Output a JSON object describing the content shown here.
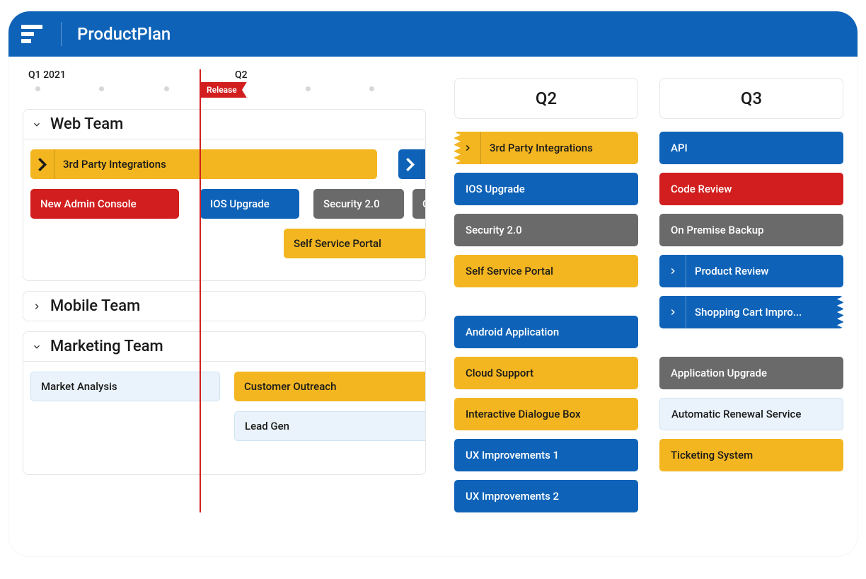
{
  "app_name": "ProductPlan",
  "timeline": {
    "q1_label": "Q1 2021",
    "q2_label": "Q2",
    "release_tag": "Release"
  },
  "lanes": {
    "web": {
      "name": "Web Team",
      "bars": {
        "third_party": "3rd Party Integrations",
        "new_admin": "New Admin Console",
        "ios": "IOS Upgrade",
        "security": "Security 2.0",
        "on_prem": "On",
        "self_serve": "Self Service Portal"
      }
    },
    "mobile": {
      "name": "Mobile Team"
    },
    "marketing": {
      "name": "Marketing Team",
      "bars": {
        "market": "Market Analysis",
        "outreach": "Customer Outreach",
        "lead": "Lead Gen"
      }
    }
  },
  "board": {
    "q2": {
      "title": "Q2",
      "group1": {
        "a": "3rd Party Integrations",
        "b": "IOS Upgrade",
        "c": "Security 2.0",
        "d": "Self Service Portal"
      },
      "group2": {
        "a": "Android Application",
        "b": "Cloud Support",
        "c": "Interactive Dialogue Box",
        "d": "UX Improvements 1",
        "e": "UX Improvements 2"
      }
    },
    "q3": {
      "title": "Q3",
      "group1": {
        "a": "API",
        "b": "Code Review",
        "c": "On Premise Backup",
        "d": "Product Review",
        "e": "Shopping Cart Impro..."
      },
      "group2": {
        "a": "Application Upgrade",
        "b": "Automatic Renewal Service",
        "c": "Ticketing System"
      }
    }
  }
}
